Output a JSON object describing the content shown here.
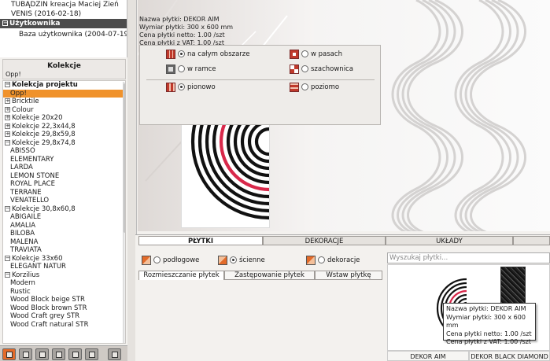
{
  "top_panel": {
    "lines": [
      "TUBĄDZIN kreacja Maciej Zień",
      "VENIS (2016-02-18)"
    ],
    "user_section": "Użytkownika",
    "user_base": "Baza użytkownika (2004-07-19"
  },
  "collections_header": {
    "title": "Kolekcje",
    "subtitle": "Opp!"
  },
  "tree": [
    {
      "label": "Kolekcja projektu",
      "level": 0,
      "toggle": "-",
      "bold": true
    },
    {
      "label": "Opp!",
      "level": 1,
      "selected": true
    },
    {
      "label": "Bricktile",
      "level": 0,
      "toggle": "+"
    },
    {
      "label": "Colour",
      "level": 0,
      "toggle": "+"
    },
    {
      "label": "Kolekcje 20x20",
      "level": 0,
      "toggle": "+"
    },
    {
      "label": "Kolekcje 22,3x44,8",
      "level": 0,
      "toggle": "+"
    },
    {
      "label": "Kolekcje 29,8x59,8",
      "level": 0,
      "toggle": "+"
    },
    {
      "label": "Kolekcje 29,8x74,8",
      "level": 0,
      "toggle": "-"
    },
    {
      "label": "ABISSO",
      "level": 1
    },
    {
      "label": "ELEMENTARY",
      "level": 1
    },
    {
      "label": "LARDA",
      "level": 1
    },
    {
      "label": "LEMON STONE",
      "level": 1
    },
    {
      "label": "ROYAL PLACE",
      "level": 1
    },
    {
      "label": "TERRANE",
      "level": 1
    },
    {
      "label": "VENATELLO",
      "level": 1
    },
    {
      "label": "Kolekcje 30,8x60,8",
      "level": 0,
      "toggle": "-"
    },
    {
      "label": "ABIGAILE",
      "level": 1
    },
    {
      "label": "AMALIA",
      "level": 1
    },
    {
      "label": "BILOBA",
      "level": 1
    },
    {
      "label": "MALENA",
      "level": 1
    },
    {
      "label": "TRAVIATA",
      "level": 1
    },
    {
      "label": "Kolekcje 33x60",
      "level": 0,
      "toggle": "-"
    },
    {
      "label": "ELEGANT NATUR",
      "level": 1
    },
    {
      "label": "Korzilius",
      "level": 0,
      "toggle": "-"
    },
    {
      "label": "Modern",
      "level": 1
    },
    {
      "label": "Rustic",
      "level": 1
    },
    {
      "label": "Wood Block beige STR",
      "level": 1
    },
    {
      "label": "Wood Block brown STR",
      "level": 1
    },
    {
      "label": "Wood Craft grey STR",
      "level": 1
    },
    {
      "label": "Wood Craft natural STR",
      "level": 1
    }
  ],
  "tile_info": {
    "name": "Nazwa płytki: DEKOR AIM",
    "size": "Wymiar płytki: 300 x 600 mm",
    "net": "Cena płytki netto:   1.00 /szt",
    "vat": "Cena płytki z VAT:   1.00 /szt"
  },
  "tabs": {
    "plytki": "PŁYTKI",
    "dekoracje": "DEKORACJE",
    "uklady": "UKŁADY"
  },
  "tile_type": {
    "floor": "podłogowe",
    "wall": "ścienne",
    "decor": "dekoracje"
  },
  "subtabs": {
    "place": "Rozmieszczanie płytek",
    "replace": "Zastępowanie płytek",
    "insert": "Wstaw płytkę"
  },
  "placement": {
    "whole": "na całym obszarze",
    "stripes": "w pasach",
    "frame": "w ramce",
    "checker": "szachownica",
    "vertical": "pionowo",
    "horizontal": "poziomo"
  },
  "search": {
    "placeholder": "Wyszukaj płytki..."
  },
  "results": [
    "DEKOR AIM",
    "DEKOR BLACK DIAMOND"
  ],
  "tooltip": {
    "name": "Nazwa płytki: DEKOR AIM",
    "size": "Wymiar płytki: 300 x 600 mm",
    "net": "Cena płytki netto:  1.00 /szt",
    "vat": "Cena płytki z VAT:  1.00 /szt"
  },
  "colors": {
    "accent": "#f0922b",
    "tile_red": "#d8284a",
    "tile_black": "#111111"
  }
}
